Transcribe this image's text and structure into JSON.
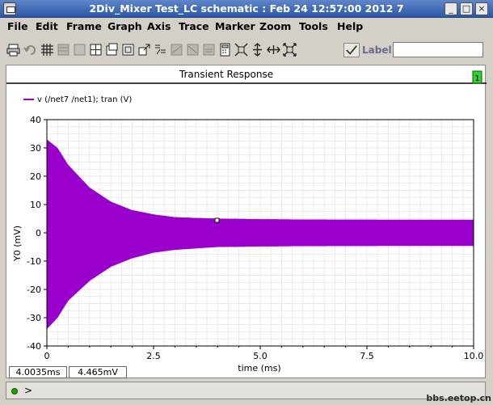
{
  "window": {
    "title": "2Div_Mixer Test_LC schematic : Feb 24 12:57:00 2012 7",
    "minimize_glyph": "_",
    "maximize_glyph": "□",
    "close_glyph": "×"
  },
  "menu": [
    "File",
    "Edit",
    "Frame",
    "Graph",
    "Axis",
    "Trace",
    "Marker",
    "Zoom",
    "Tools",
    "Help"
  ],
  "toolbar": {
    "icons": [
      "print-icon",
      "undo-icon",
      "grid-icon",
      "list-icon",
      "window-icon",
      "split-icon",
      "new-window-icon",
      "subwindow-icon",
      "popout-icon",
      "marker-icon",
      "strip-icon",
      "strip2-icon",
      "calc-icon",
      "calculator-icon",
      "fit-all-icon",
      "fit-y-icon",
      "fit-x-icon",
      "zoom-box-icon"
    ],
    "label_text": "Label",
    "label_value": ""
  },
  "plot": {
    "subwindow_title": "Transient Response",
    "subwindow_index": "1",
    "trace_color": "#9a00cc",
    "grid_color": "#e3e3e3"
  },
  "chart_data": {
    "type": "line",
    "title": "Transient Response",
    "legend": [
      "v (/net7 /net1); tran (V)"
    ],
    "xlabel": "time (ms)",
    "ylabel": "Y0 (mV)",
    "xlim": [
      0,
      10.0
    ],
    "ylim": [
      -40,
      40
    ],
    "x_ticks": [
      "0",
      "2.5",
      "5.0",
      "7.5",
      "10.0"
    ],
    "y_ticks": [
      "40",
      "30",
      "20",
      "10",
      "0",
      "-10",
      "-20",
      "-30",
      "-40"
    ],
    "grid": true,
    "series": [
      {
        "name": "v (/net7 /net1); tran (V)",
        "envelope_time_ms": [
          0,
          0.25,
          0.5,
          1.0,
          1.5,
          2.0,
          2.5,
          3.0,
          4.0,
          5.0,
          6.0,
          8.0,
          10.0
        ],
        "envelope_upper_mV": [
          33,
          30,
          24,
          16,
          11,
          8,
          6.5,
          5.5,
          5,
          4.8,
          4.7,
          4.6,
          4.6
        ],
        "envelope_lower_mV": [
          -34,
          -30,
          -24,
          -17,
          -12,
          -9,
          -7,
          -6,
          -5,
          -4.8,
          -4.7,
          -4.6,
          -4.6
        ]
      }
    ]
  },
  "readouts": {
    "x": "4.0035ms",
    "y": "4.465mV"
  },
  "command": {
    "prompt": ">"
  },
  "watermark": "bbs.eetop.cn"
}
